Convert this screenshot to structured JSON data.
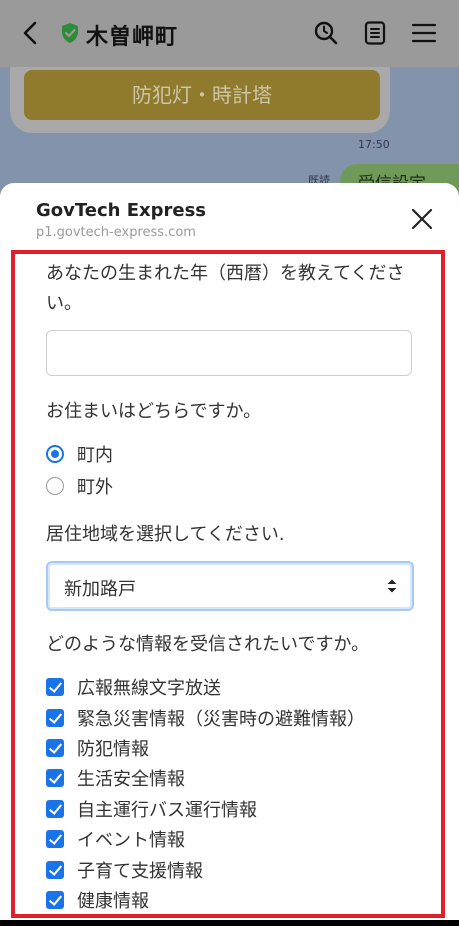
{
  "header": {
    "title": "木曽岬町",
    "icons": [
      "back-arrow-icon",
      "verified-shield-icon",
      "search-icon",
      "notes-icon",
      "menu-icon"
    ]
  },
  "chat": {
    "button_label": "防犯灯・時計塔",
    "time": "17:50",
    "read_mark": "既読",
    "bubble_text": "受信設定"
  },
  "sheet": {
    "title": "GovTech Express",
    "url": "p1.govtech-express.com"
  },
  "form": {
    "q_birth_year": "あなたの生まれた年（西暦）を教えてください。",
    "birth_year_value": "",
    "q_residence": "お住まいはどちらですか。",
    "residence_options": [
      {
        "label": "町内",
        "selected": true
      },
      {
        "label": "町外",
        "selected": false
      }
    ],
    "q_area": "居住地域を選択してください.",
    "area_selected": "新加路戸",
    "q_info": "どのような情報を受信されたいですか。",
    "info_options": [
      {
        "label": "広報無線文字放送",
        "checked": true
      },
      {
        "label": "緊急災害情報（災害時の避難情報）",
        "checked": true
      },
      {
        "label": "防犯情報",
        "checked": true
      },
      {
        "label": "生活安全情報",
        "checked": true
      },
      {
        "label": "自主運行バス運行情報",
        "checked": true
      },
      {
        "label": "イベント情報",
        "checked": true
      },
      {
        "label": "子育て支援情報",
        "checked": true
      },
      {
        "label": "健康情報",
        "checked": true
      }
    ]
  },
  "colors": {
    "accent": "#1a73e8",
    "highlight_border": "#e0202a",
    "verified_green": "#2e8b3a"
  }
}
